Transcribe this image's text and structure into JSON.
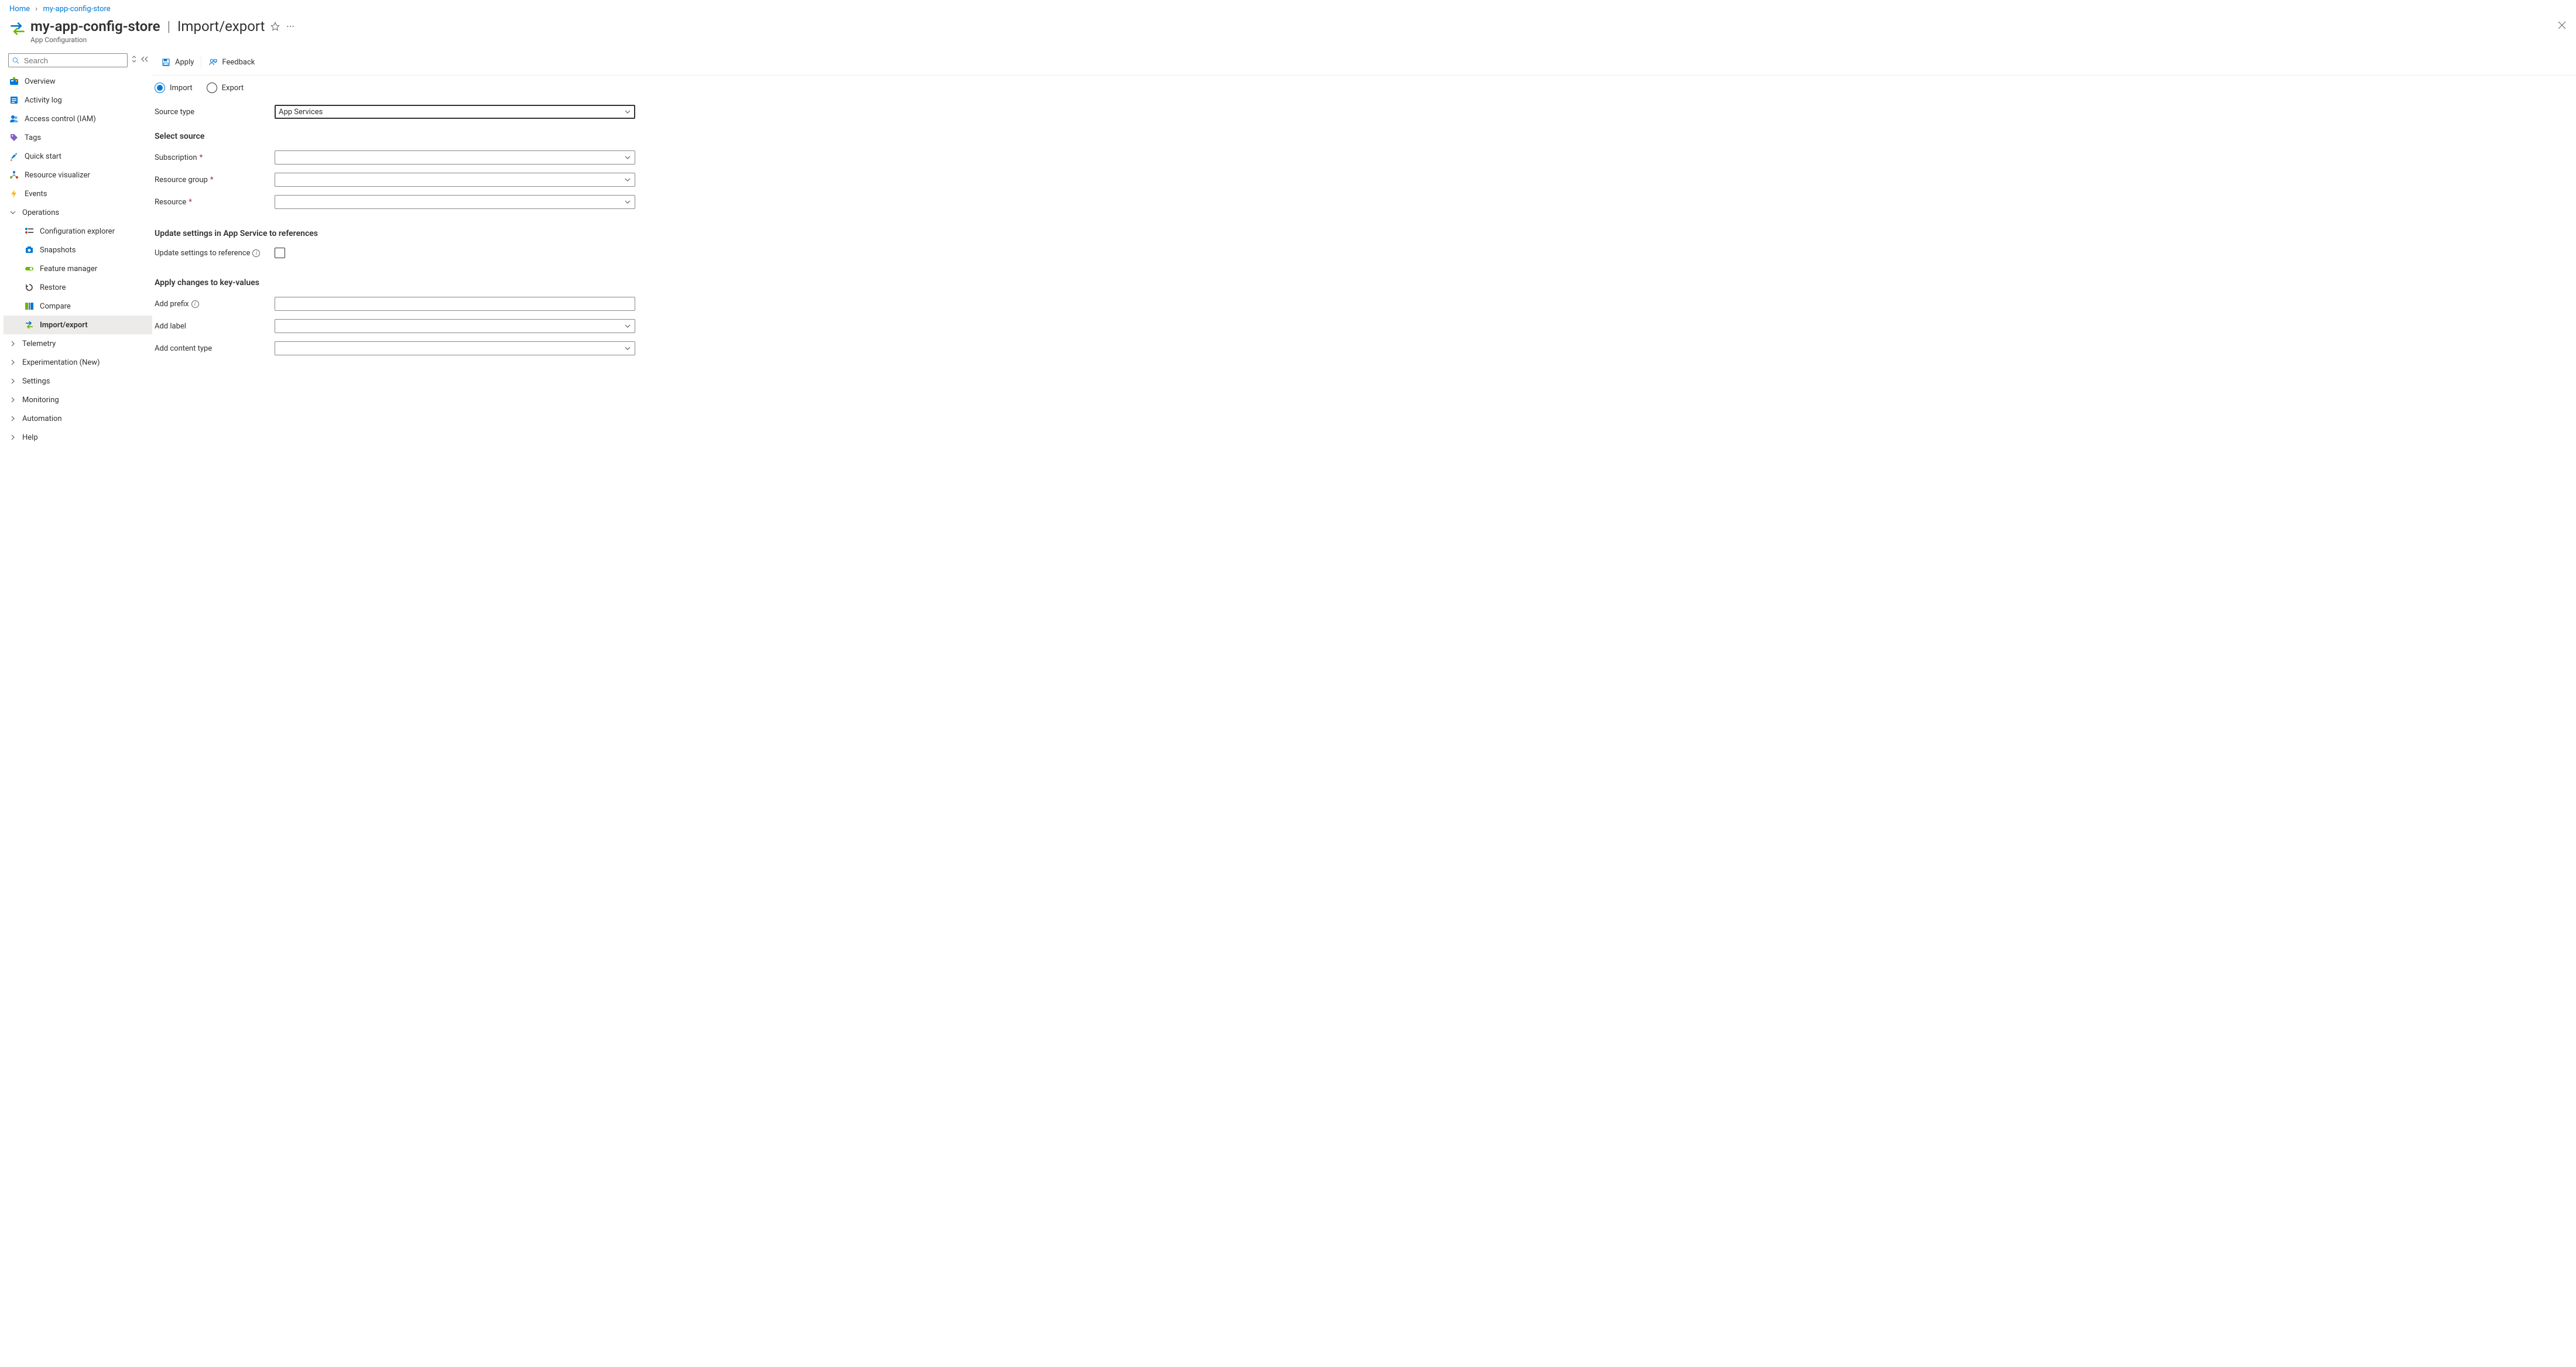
{
  "breadcrumb": {
    "home": "Home",
    "resource": "my-app-config-store"
  },
  "header": {
    "resource_name": "my-app-config-store",
    "page_name": "Import/export",
    "service": "App Configuration"
  },
  "sidebar": {
    "search_placeholder": "Search",
    "items": {
      "overview": "Overview",
      "activity_log": "Activity log",
      "access_control": "Access control (IAM)",
      "tags": "Tags",
      "quick_start": "Quick start",
      "resource_visualizer": "Resource visualizer",
      "events": "Events"
    },
    "groups": {
      "operations": {
        "label": "Operations",
        "children": {
          "config_explorer": "Configuration explorer",
          "snapshots": "Snapshots",
          "feature_manager": "Feature manager",
          "restore": "Restore",
          "compare": "Compare",
          "import_export": "Import/export"
        }
      },
      "telemetry": "Telemetry",
      "experimentation": "Experimentation (New)",
      "settings": "Settings",
      "monitoring": "Monitoring",
      "automation": "Automation",
      "help": "Help"
    }
  },
  "toolbar": {
    "apply": "Apply",
    "feedback": "Feedback"
  },
  "form": {
    "radio_import": "Import",
    "radio_export": "Export",
    "source_type_label": "Source type",
    "source_type_value": "App Services",
    "section_select_source": "Select source",
    "subscription_label": "Subscription",
    "resource_group_label": "Resource group",
    "resource_label": "Resource",
    "section_update": "Update settings in App Service to references",
    "update_reference_label": "Update settings to reference",
    "section_apply_changes": "Apply changes to key-values",
    "add_prefix_label": "Add prefix",
    "add_label_label": "Add label",
    "add_content_type_label": "Add content type"
  }
}
